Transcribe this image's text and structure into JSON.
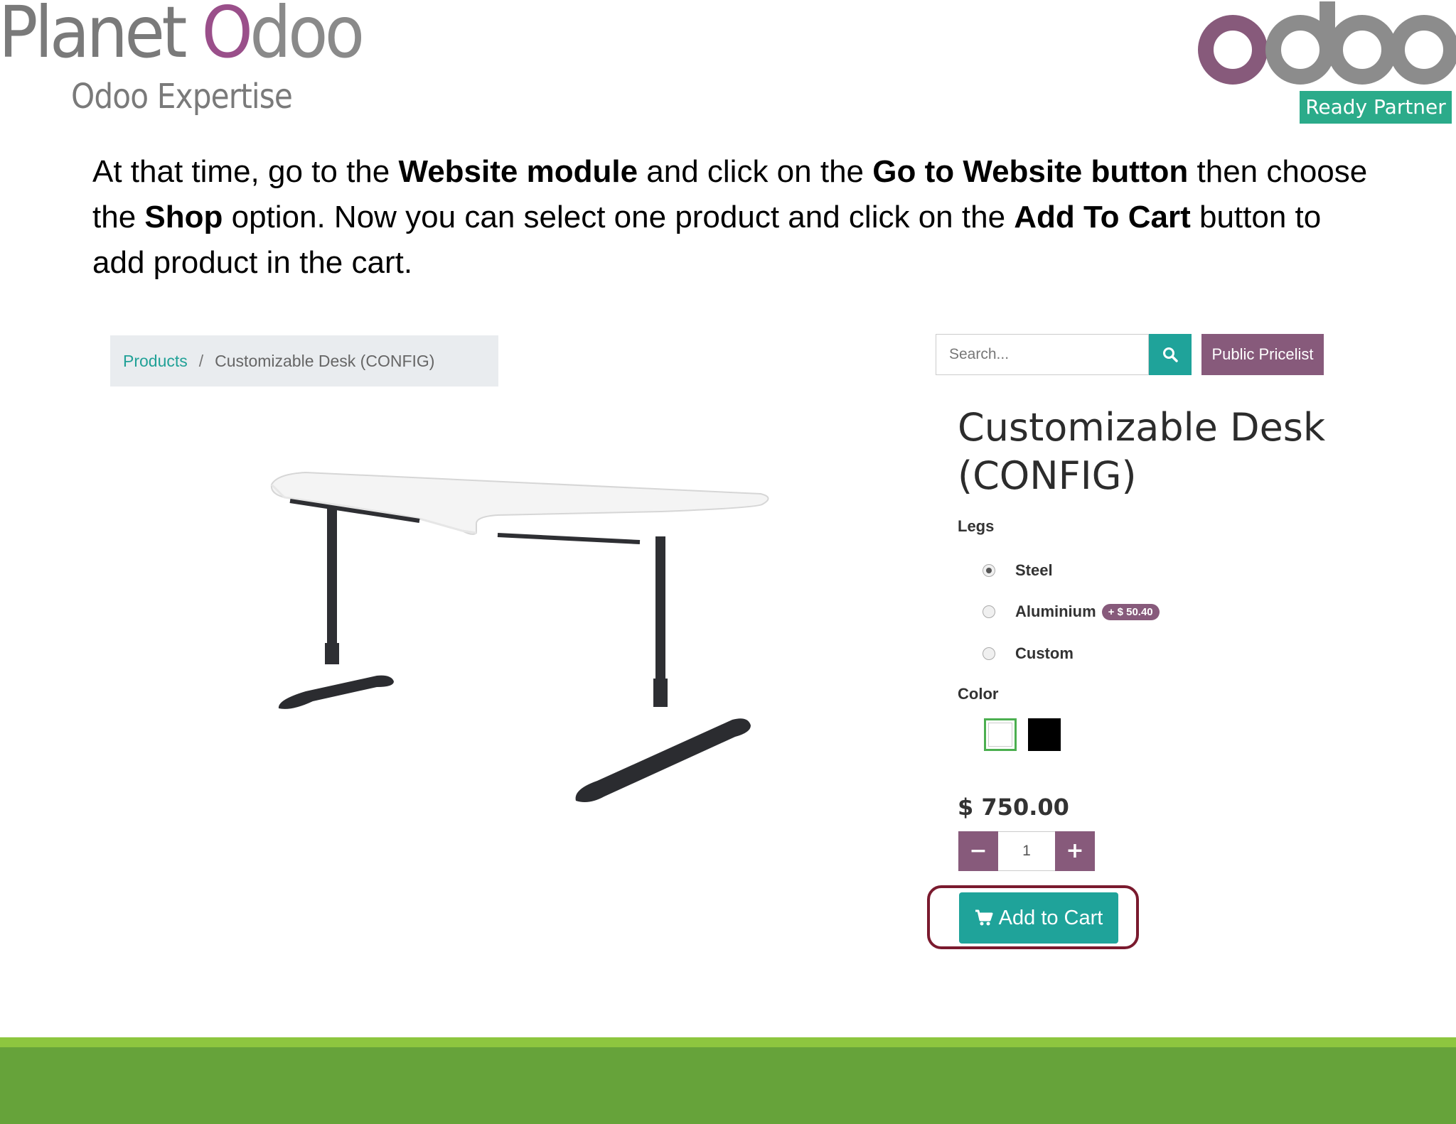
{
  "header": {
    "planet_logo": {
      "word1": "Planet",
      "word2_first": "O",
      "word2_rest": "doo",
      "tagline": "Odoo Expertise"
    },
    "odoo_logo": {
      "wordmark": "odoo",
      "badge": "Ready Partner"
    },
    "colors": {
      "odoo_purple": "#875a7b",
      "odoo_grey": "#8c8c8c",
      "badge_green": "#2bab8a"
    }
  },
  "instruction": {
    "t1": "At that time, go to the ",
    "b1": "Website module",
    "t2": " and click on the ",
    "b2": "Go to Website button",
    "t3": " then choose the ",
    "b3": "Shop",
    "t4": " option. Now you can select one product and click on the ",
    "b4": "Add To Cart",
    "t5": " button to add product in the cart."
  },
  "shop": {
    "breadcrumb": {
      "link": "Products",
      "separator": "/",
      "current": "Customizable Desk (CONFIG)"
    },
    "search": {
      "placeholder": "Search...",
      "icon": "search-icon"
    },
    "pricelist_button": "Public Pricelist",
    "product": {
      "title": "Customizable Desk (CONFIG)",
      "legs_label": "Legs",
      "legs_options": [
        {
          "label": "Steel",
          "selected": true,
          "extra": ""
        },
        {
          "label": "Aluminium",
          "selected": false,
          "extra": "+ $ 50.40"
        },
        {
          "label": "Custom",
          "selected": false,
          "extra": ""
        }
      ],
      "color_label": "Color",
      "colors": [
        {
          "name": "white",
          "value": "#ffffff",
          "selected": true
        },
        {
          "name": "black",
          "value": "#000000",
          "selected": false
        }
      ],
      "price": "$ 750.00",
      "quantity": "1",
      "qty_minus": "−",
      "qty_plus": "+",
      "add_to_cart": "Add to Cart",
      "cart_icon": "shopping-cart-icon"
    },
    "colors": {
      "accent_teal": "#1fa39a",
      "accent_purple": "#875a7b",
      "highlight": "#7a1a2e"
    }
  },
  "footer": {
    "colors": {
      "light_green": "#8dc63f",
      "dark_green": "#66a33a"
    }
  }
}
